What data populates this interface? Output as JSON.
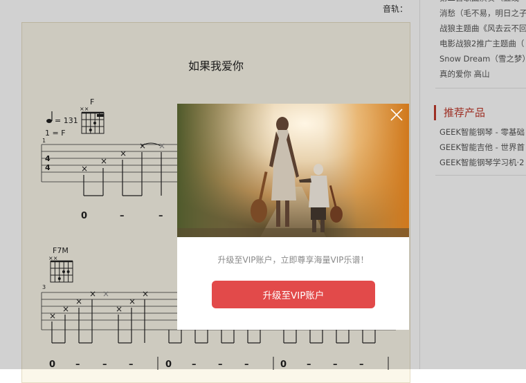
{
  "header": {
    "track_label": "音轨："
  },
  "sheet": {
    "title": "如果我爱你",
    "tempo": "= 131",
    "key": "1 = F",
    "time_sig_top": "4",
    "time_sig_bottom": "4",
    "chords": [
      "F",
      "F7M"
    ],
    "measure_numbers": [
      "1",
      "3"
    ],
    "row1_rhythm": [
      "0",
      "–",
      "–"
    ],
    "row2_rhythm": [
      "0",
      "–",
      "–",
      "–",
      "0",
      "–",
      "–",
      "–",
      "0",
      "–",
      "–",
      "–"
    ],
    "string_mark": "×"
  },
  "sidebar": {
    "top_items": [
      "第二首歌曲演奏（五线",
      "消愁（毛不易，明日之子",
      "战狼主题曲《风去云不回",
      "电影战狼2推广主题曲（",
      "Snow Dream（雪之梦）",
      "真的爱你 高山"
    ],
    "recommend_title": "推荐产品",
    "recommend_items": [
      "GEEK智能钢琴 - 零基础",
      "GEEK智能吉他 - 世界首",
      "GEEK智能钢琴学习机·2"
    ]
  },
  "modal": {
    "photo_icon": "mother-child-guitar-photo",
    "close_icon": "close-icon",
    "promo_text": "升级至VIP账户，立即尊享海量VIP乐谱！",
    "cta_label": "升级至VIP账户"
  },
  "colors": {
    "accent": "#e24a4a",
    "sidebar_accent": "#c0392b",
    "sheet_bg": "#fbf7ea"
  }
}
